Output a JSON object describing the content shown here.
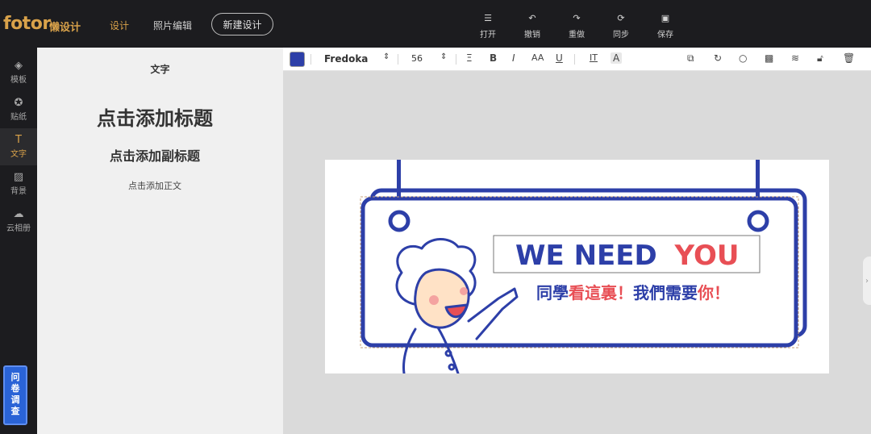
{
  "app": {
    "logo": "fotor",
    "logo_sub": "懒设计"
  },
  "nav": {
    "design": "设计",
    "photo_edit": "照片编辑",
    "new_design": "新建设计"
  },
  "toolbar": {
    "open": "打开",
    "undo": "撤销",
    "redo": "重做",
    "sync": "同步",
    "save": "保存"
  },
  "rail": {
    "templates": "模板",
    "stickers": "贴纸",
    "text": "文字",
    "background": "背景",
    "cloud": "云相册",
    "survey": "问卷调查"
  },
  "panel": {
    "title": "文字",
    "add_heading": "点击添加标题",
    "add_subheading": "点击添加副标题",
    "add_body": "点击添加正文"
  },
  "format": {
    "color": "#2d3fa8",
    "font": "Fredoka",
    "size": "56",
    "align": "Ξ",
    "bold": "B",
    "italic": "I",
    "case": "AA",
    "underline": "U",
    "spacing": "IT",
    "effect": "A"
  },
  "canvas": {
    "headline_part1": "WE NEED",
    "headline_part2": "YOU",
    "sub_part1": "同學",
    "sub_part2": "看這裏！",
    "sub_part3": "我們需要",
    "sub_part4": "你！",
    "colors": {
      "blue": "#2d3fa8",
      "red": "#e84f55",
      "skin": "#ffe2c6"
    }
  }
}
